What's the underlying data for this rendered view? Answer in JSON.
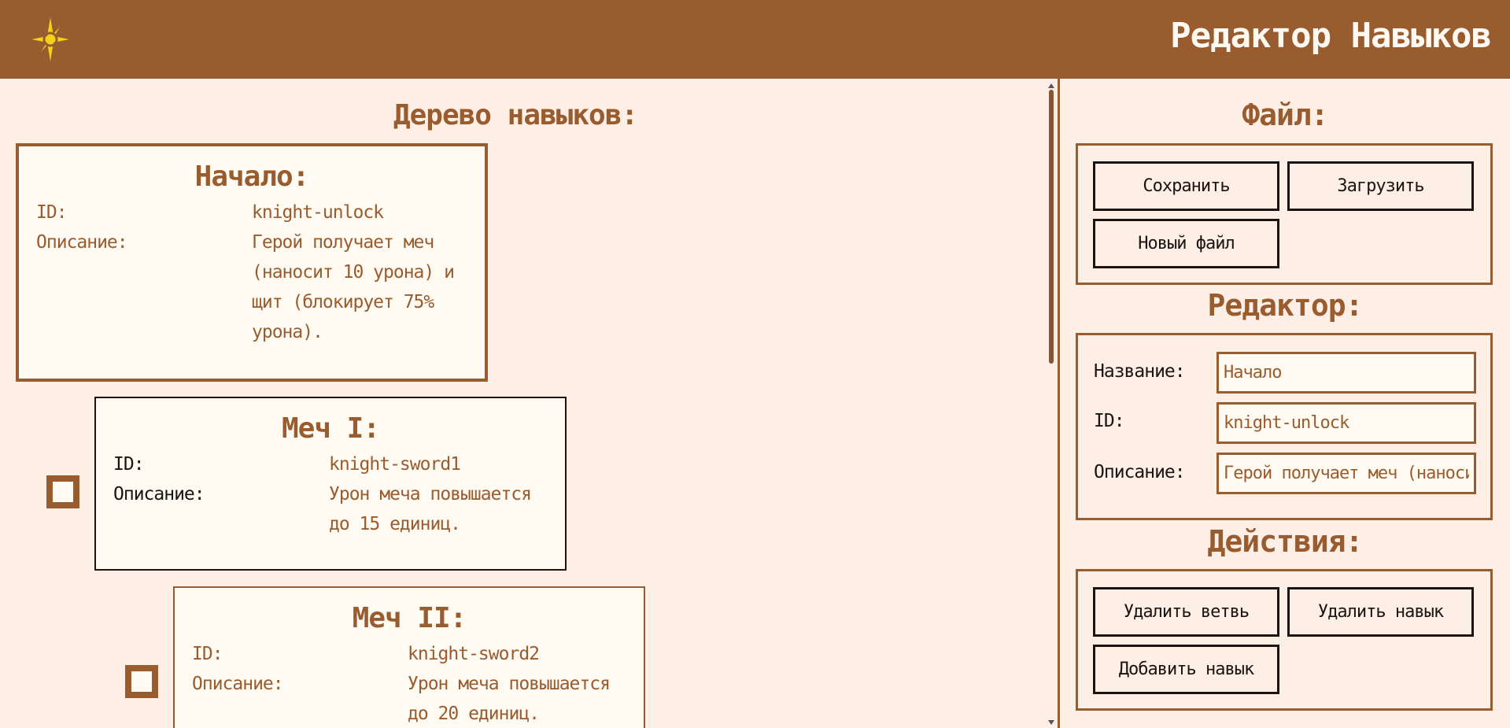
{
  "header": {
    "logo_icon": "compass-star-icon",
    "title": "Редактор Навыков",
    "bg_color": "#995c2f"
  },
  "tree": {
    "heading": "Дерево навыков:",
    "id_label": "ID:",
    "desc_label": "Описание:",
    "skills": [
      {
        "title": "Начало:",
        "id": "knight-unlock",
        "description": [
          "Герой получает меч",
          "(наносит 10 урона) и",
          "щит (блокирует 75%",
          "урона)."
        ]
      },
      {
        "title": "Меч I:",
        "id": "knight-sword1",
        "description": [
          "Урон меча повышается",
          "до 15 единиц."
        ]
      },
      {
        "title": "Меч II:",
        "id": "knight-sword2",
        "description": [
          "Урон меча повышается",
          "до 20 единиц."
        ]
      }
    ]
  },
  "file_panel": {
    "heading": "Файл:",
    "save_label": "Сохранить",
    "load_label": "Загрузить",
    "new_label": "Новый файл"
  },
  "editor_panel": {
    "heading": "Редактор:",
    "name_label": "Название:",
    "name_value": "Начало",
    "id_label": "ID:",
    "id_value": "knight-unlock",
    "desc_label": "Описание:",
    "desc_value": "Герой получает меч (наноси"
  },
  "actions_panel": {
    "heading": "Действия:",
    "delete_branch_label": "Удалить ветвь",
    "delete_skill_label": "Удалить навык",
    "add_skill_label": "Добавить навык"
  }
}
